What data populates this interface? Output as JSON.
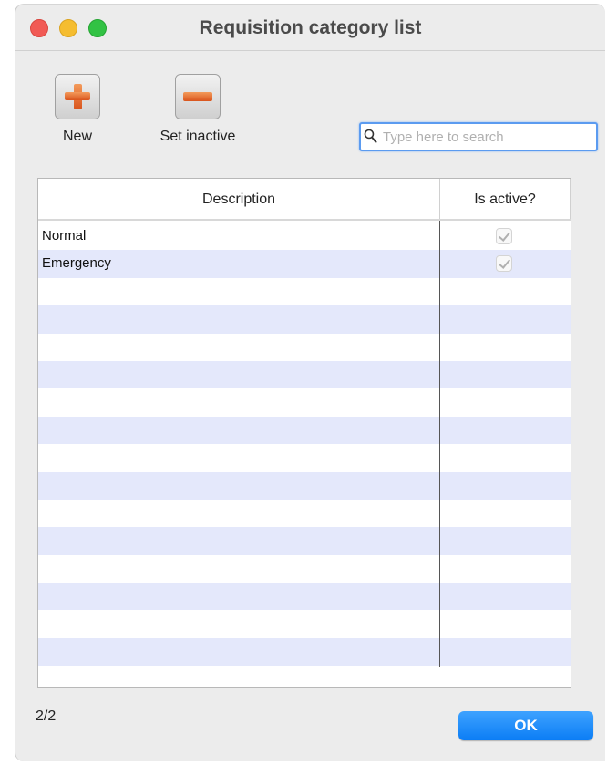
{
  "window": {
    "title": "Requisition category list"
  },
  "toolbar": {
    "new_label": "New",
    "set_inactive_label": "Set inactive"
  },
  "search": {
    "placeholder": "Type here to search",
    "value": ""
  },
  "table": {
    "columns": [
      "Description",
      "Is active?"
    ],
    "rows": [
      {
        "description": "Normal",
        "is_active": true
      },
      {
        "description": "Emergency",
        "is_active": true
      }
    ]
  },
  "footer": {
    "count": "2/2",
    "ok_label": "OK"
  },
  "colors": {
    "accent": "#0b7df5",
    "row_stripe": "#e4e8fb",
    "add_icon": "#e06a2b"
  },
  "icons": {
    "new": "plus-icon",
    "set_inactive": "minus-icon",
    "search": "magnifier-icon",
    "check": "checkmark-icon"
  }
}
